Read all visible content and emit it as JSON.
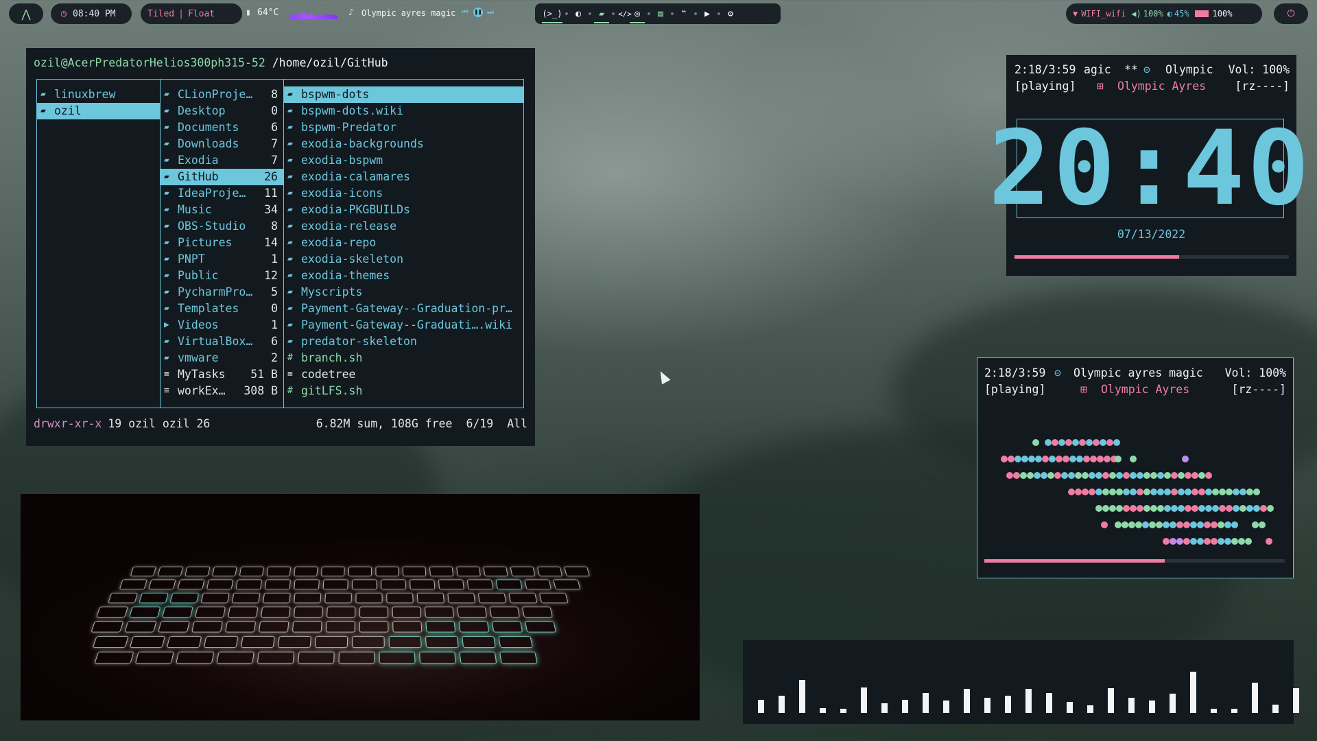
{
  "topbar": {
    "logo_icon": "arch-arrow-icon",
    "time": "08:40 PM",
    "layout_tiled": "Tiled",
    "layout_sep": "|",
    "layout_float": "Float",
    "temperature": "64°C",
    "now_playing": "Olympic ayres magic",
    "wifi": "WIFI_wifi",
    "volume": "100%",
    "brightness": "45%",
    "battery": "100%"
  },
  "filemanager": {
    "user_host": "ozil@AcerPredatorHelios300ph315-52",
    "path": "/home/ozil/GitHub",
    "col1": [
      {
        "name": "linuxbrew",
        "count": ""
      },
      {
        "name": "ozil",
        "count": ""
      }
    ],
    "col2": [
      {
        "name": "CLionProje…",
        "count": "8"
      },
      {
        "name": "Desktop",
        "count": "0"
      },
      {
        "name": "Documents",
        "count": "6"
      },
      {
        "name": "Downloads",
        "count": "7"
      },
      {
        "name": "Exodia",
        "count": "7"
      },
      {
        "name": "GitHub",
        "count": "26"
      },
      {
        "name": "IdeaProje…",
        "count": "11"
      },
      {
        "name": "Music",
        "count": "34"
      },
      {
        "name": "OBS-Studio",
        "count": "8"
      },
      {
        "name": "Pictures",
        "count": "14"
      },
      {
        "name": "PNPT",
        "count": "1"
      },
      {
        "name": "Public",
        "count": "12"
      },
      {
        "name": "PycharmPro…",
        "count": "5"
      },
      {
        "name": "Templates",
        "count": "0"
      },
      {
        "name": "Videos",
        "count": "1"
      },
      {
        "name": "VirtualBox…",
        "count": "6"
      },
      {
        "name": "vmware",
        "count": "2"
      },
      {
        "name": "MyTasks",
        "count": "51 B"
      },
      {
        "name": "workEx…",
        "count": "308 B"
      }
    ],
    "col3": [
      "bspwm-dots",
      "bspwm-dots.wiki",
      "bspwm-Predator",
      "exodia-backgrounds",
      "exodia-bspwm",
      "exodia-calamares",
      "exodia-icons",
      "exodia-PKGBUILDs",
      "exodia-release",
      "exodia-repo",
      "exodia-skeleton",
      "exodia-themes",
      "Myscripts",
      "Payment-Gateway--Graduation-pr…",
      "Payment-Gateway--Graduati….wiki",
      "predator-skeleton",
      "branch.sh",
      "codetree",
      "gitLFS.sh"
    ],
    "status": {
      "perms": "drwxr-xr-x",
      "info": "19 ozil ozil 26",
      "summary": "6.82M sum, 108G free",
      "position": "6/19",
      "scope": "All"
    }
  },
  "clock_widget": {
    "line1_time": "2:18/3:59",
    "line1_title": "agic",
    "line1_mark": "**",
    "line1_artist": "Olympic",
    "line1_vol": "Vol: 100%",
    "line2_state": "[playing]",
    "line2_album": "Olympic Ayres",
    "line2_flags": "[rz----]",
    "clock": "20:40",
    "date": "07/13/2022",
    "progress": 0.6
  },
  "music_widget": {
    "line1_time": "2:18/3:59",
    "line1_title": "Olympic ayres magic",
    "line1_vol": "Vol: 100%",
    "line2_state": "[playing]",
    "line2_album": "Olympic Ayres",
    "line2_flags": "[rz----]",
    "progress": 0.6
  },
  "colors": {
    "accent_cyan": "#6cc6dc",
    "accent_pink": "#f07ca1",
    "accent_green": "#8fd9a8",
    "panel_bg": "#121a20"
  },
  "visualizer_levels": [
    0.32,
    0.42,
    0.8,
    0.12,
    0.08,
    0.62,
    0.24,
    0.32,
    0.48,
    0.3,
    0.58,
    0.36,
    0.42,
    0.58,
    0.48,
    0.26,
    0.18,
    0.6,
    0.36,
    0.3,
    0.46,
    1.0,
    0.08,
    0.06,
    0.74,
    0.2,
    0.6
  ]
}
